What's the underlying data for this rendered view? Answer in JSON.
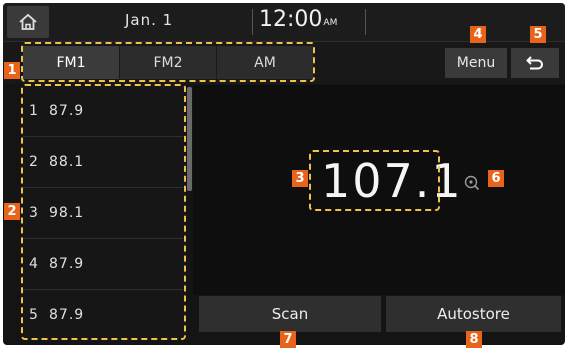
{
  "status": {
    "date": "Jan.  1",
    "time": "12:00",
    "ampm": "AM"
  },
  "bands": [
    "FM1",
    "FM2",
    "AM"
  ],
  "active_band": "FM1",
  "menu_label": "Menu",
  "presets": [
    {
      "num": "1",
      "freq": "87.9"
    },
    {
      "num": "2",
      "freq": "88.1"
    },
    {
      "num": "3",
      "freq": "98.1"
    },
    {
      "num": "4",
      "freq": "87.9"
    },
    {
      "num": "5",
      "freq": "87.9"
    }
  ],
  "current_frequency": "107.1",
  "buttons": {
    "scan": "Scan",
    "autostore": "Autostore"
  },
  "callouts": {
    "c1": "1",
    "c2": "2",
    "c3": "3",
    "c4": "4",
    "c5": "5",
    "c6": "6",
    "c7": "7",
    "c8": "8"
  },
  "colors": {
    "callout": "#e8641b",
    "highlight_border": "#f0c14b",
    "background": "#141414"
  }
}
